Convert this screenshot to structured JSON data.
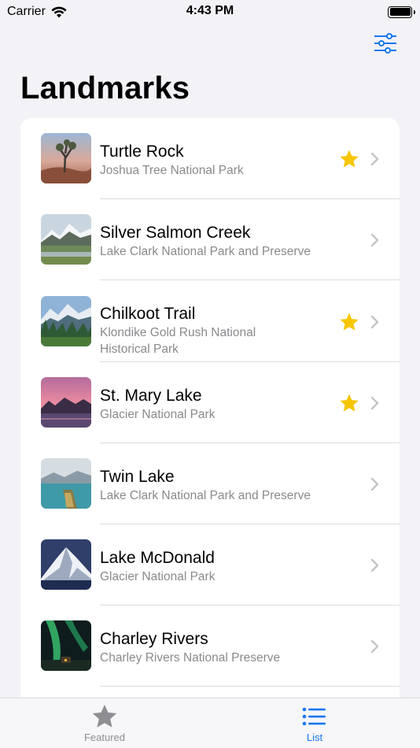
{
  "status_bar": {
    "carrier": "Carrier",
    "time": "4:43 PM"
  },
  "header": {
    "title": "Landmarks",
    "filter_icon": "sliders-icon"
  },
  "landmarks": [
    {
      "name": "Turtle Rock",
      "park": "Joshua Tree National Park",
      "favorite": true
    },
    {
      "name": "Silver Salmon Creek",
      "park": "Lake Clark National Park and Preserve",
      "favorite": false
    },
    {
      "name": "Chilkoot Trail",
      "park": "Klondike Gold Rush National Historical Park",
      "park_lines": [
        "Klondike Gold Rush National",
        "Historical Park"
      ],
      "favorite": true
    },
    {
      "name": "St. Mary Lake",
      "park": "Glacier National Park",
      "favorite": true
    },
    {
      "name": "Twin Lake",
      "park": "Lake Clark National Park and Preserve",
      "favorite": false
    },
    {
      "name": "Lake McDonald",
      "park": "Glacier National Park",
      "favorite": false
    },
    {
      "name": "Charley Rivers",
      "park": "Charley Rivers National Preserve",
      "favorite": false
    }
  ],
  "tab_bar": {
    "tabs": [
      {
        "label": "Featured",
        "icon": "star-icon",
        "selected": false
      },
      {
        "label": "List",
        "icon": "list-icon",
        "selected": true
      }
    ]
  },
  "colors": {
    "accent": "#1677f0",
    "favorite_star": "#f7c600",
    "secondary_text": "#8a8a8e",
    "background": "#f2f2f7"
  }
}
